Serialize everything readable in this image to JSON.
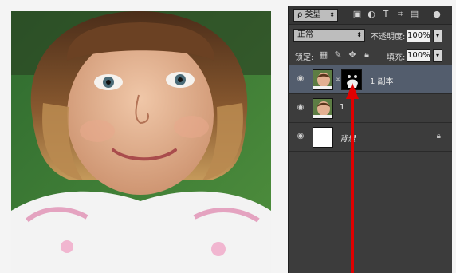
{
  "panel": {
    "filter_kind": "ρ 类型",
    "blend_mode": "正常",
    "opacity_label": "不透明度:",
    "opacity_value": "100%",
    "lock_label": "锁定:",
    "fill_label": "填充:",
    "fill_value": "100%"
  },
  "layers": [
    {
      "name": "1 副本",
      "visible": true,
      "selected": true,
      "has_mask": true
    },
    {
      "name": "1",
      "visible": true,
      "selected": false,
      "has_mask": false
    },
    {
      "name": "背景",
      "visible": true,
      "selected": false,
      "locked": true
    }
  ],
  "icons": {
    "toolbar": [
      "image-filter-icon",
      "adjustment-filter-icon",
      "text-filter-icon",
      "shape-filter-icon",
      "smart-object-filter-icon",
      "filter-toggle-icon"
    ],
    "lock": [
      "lock-transparent-icon",
      "lock-image-icon",
      "lock-position-icon",
      "lock-all-icon"
    ]
  },
  "colors": {
    "panel_bg": "#3c3c3c",
    "selected_layer": "#535d6d",
    "arrow": "#e10000"
  }
}
